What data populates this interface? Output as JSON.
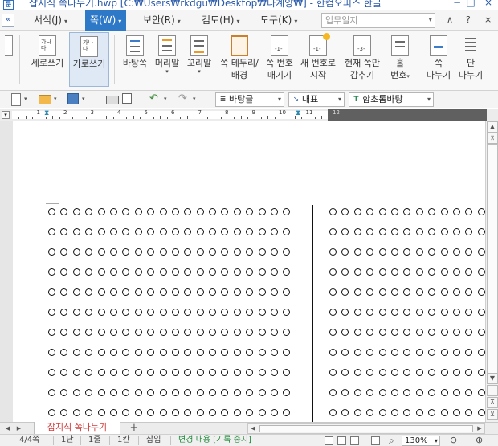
{
  "window": {
    "app_icon_label": "문",
    "title": "잡지식 쪽나누기.hwp [C:₩Users₩rkdgu₩Desktop₩다계양₩] - 한컴오피스 한글",
    "minimize_glyph": "−",
    "maximize_glyph": "□",
    "close_glyph": "×"
  },
  "menubar": {
    "collapse_glyph": "«",
    "items": [
      {
        "label": "서식(J)"
      },
      {
        "label": "쪽(W)"
      },
      {
        "label": "보안(R)"
      },
      {
        "label": "검토(H)"
      },
      {
        "label": "도구(K)"
      }
    ],
    "caret": "▾",
    "search_placeholder": "업무일지",
    "search_caret": "▾",
    "expand_glyph": "∧",
    "help_glyph": "?",
    "ribbon_close_glyph": "×"
  },
  "ribbon": {
    "buttons": [
      {
        "label": "세로쓰기",
        "icon_text": "가나\n다"
      },
      {
        "label": "가로쓰기",
        "icon_text": "가나\n다"
      },
      {
        "label": "바탕쪽",
        "icon_text": ""
      },
      {
        "label": "머리말",
        "icon_text": ""
      },
      {
        "label": "꼬리말",
        "icon_text": ""
      },
      {
        "label": "쪽 테두리/",
        "label2": "배경",
        "icon_text": ""
      },
      {
        "label": "쪽 번호",
        "label2": "매기기",
        "icon_text": "-1-"
      },
      {
        "label": "새 번호로",
        "label2": "시작",
        "icon_text": "-1-"
      },
      {
        "label": "현재 쪽만",
        "label2": "감추기",
        "icon_text": "-3-"
      },
      {
        "label": "홀",
        "label2": "번호",
        "icon_text": ""
      },
      {
        "label": "쪽",
        "label2": "나누기",
        "icon_text": ""
      },
      {
        "label": "단",
        "label2": "나누기",
        "icon_text": ""
      }
    ],
    "dropdown_glyph": "▾"
  },
  "toolbar": {
    "style_combo": "바탕글",
    "font_combo": "대표",
    "face_combo": "함초롬바탕",
    "combo_caret": "▾",
    "style_icon": "≣",
    "font_icon": "↘",
    "face_icon": "T"
  },
  "ruler": {
    "labels": [
      "1",
      "2",
      "3",
      "4",
      "5",
      "6",
      "7",
      "8",
      "9",
      "10",
      "11",
      "12"
    ],
    "corner_glyph": "▾"
  },
  "document": {
    "circle_rows": 11,
    "left_column_circles": 20,
    "right_column_circles": 13
  },
  "scrollbar": {
    "up_glyph": "▲",
    "down_glyph": "▼",
    "page_up_glyph": "⊼",
    "page_down_glyph": "⊻"
  },
  "tabs": {
    "nav_glyphs": [
      "◀",
      "▶"
    ],
    "doc_tab": "잡지식 쪽나누기",
    "add_glyph": "+",
    "hs_left": "◀",
    "hs_right": "▶"
  },
  "status": {
    "page": "4/4쪽",
    "section": "1단",
    "line": "1줄",
    "column": "1칸",
    "mode": "삽입",
    "track": "변경 내용 [기록 중지]",
    "zoom": "130%",
    "zoom_caret": "▾",
    "zoom_out": "⊖",
    "zoom_in": "⊕"
  }
}
